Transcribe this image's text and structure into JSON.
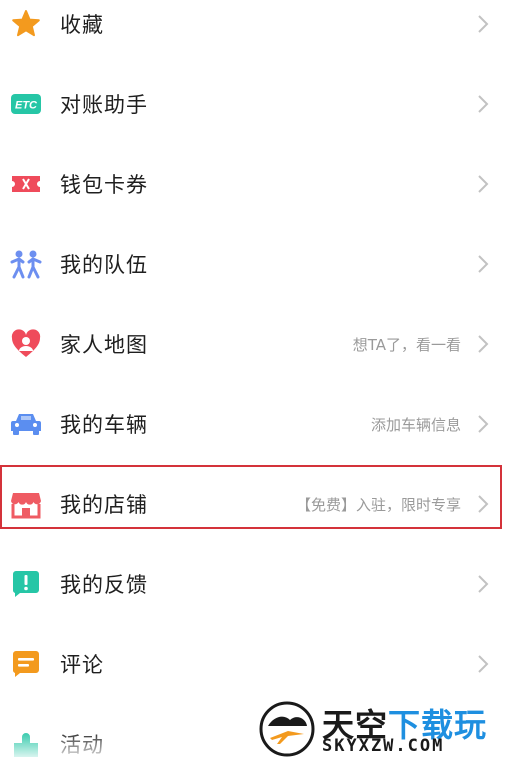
{
  "menu": {
    "items": [
      {
        "label": "收藏",
        "hint": "",
        "icon": "star-icon",
        "color": "#f39a1e"
      },
      {
        "label": "对账助手",
        "hint": "",
        "icon": "etc-icon",
        "color": "#26c6a6"
      },
      {
        "label": "钱包卡券",
        "hint": "",
        "icon": "ticket-icon",
        "color": "#ef4b5b"
      },
      {
        "label": "我的队伍",
        "hint": "",
        "icon": "team-icon",
        "color": "#6d8ff0"
      },
      {
        "label": "家人地图",
        "hint": "想TA了，看一看",
        "icon": "family-heart-icon",
        "color": "#ef4b5b"
      },
      {
        "label": "我的车辆",
        "hint": "添加车辆信息",
        "icon": "car-icon",
        "color": "#5b8ef0"
      },
      {
        "label": "我的店铺",
        "hint": "【免费】入驻，限时专享",
        "icon": "store-icon",
        "color": "#ef5b63"
      },
      {
        "label": "我的反馈",
        "hint": "",
        "icon": "feedback-icon",
        "color": "#26c6a6"
      },
      {
        "label": "评论",
        "hint": "",
        "icon": "comment-icon",
        "color": "#f39a1e"
      },
      {
        "label": "活动",
        "hint": "",
        "icon": "activity-icon",
        "color": "#26c6a6"
      }
    ]
  },
  "watermark": {
    "title_main": "天空",
    "title_accent": "下载玩",
    "domain": "SKYXZW.COM"
  }
}
